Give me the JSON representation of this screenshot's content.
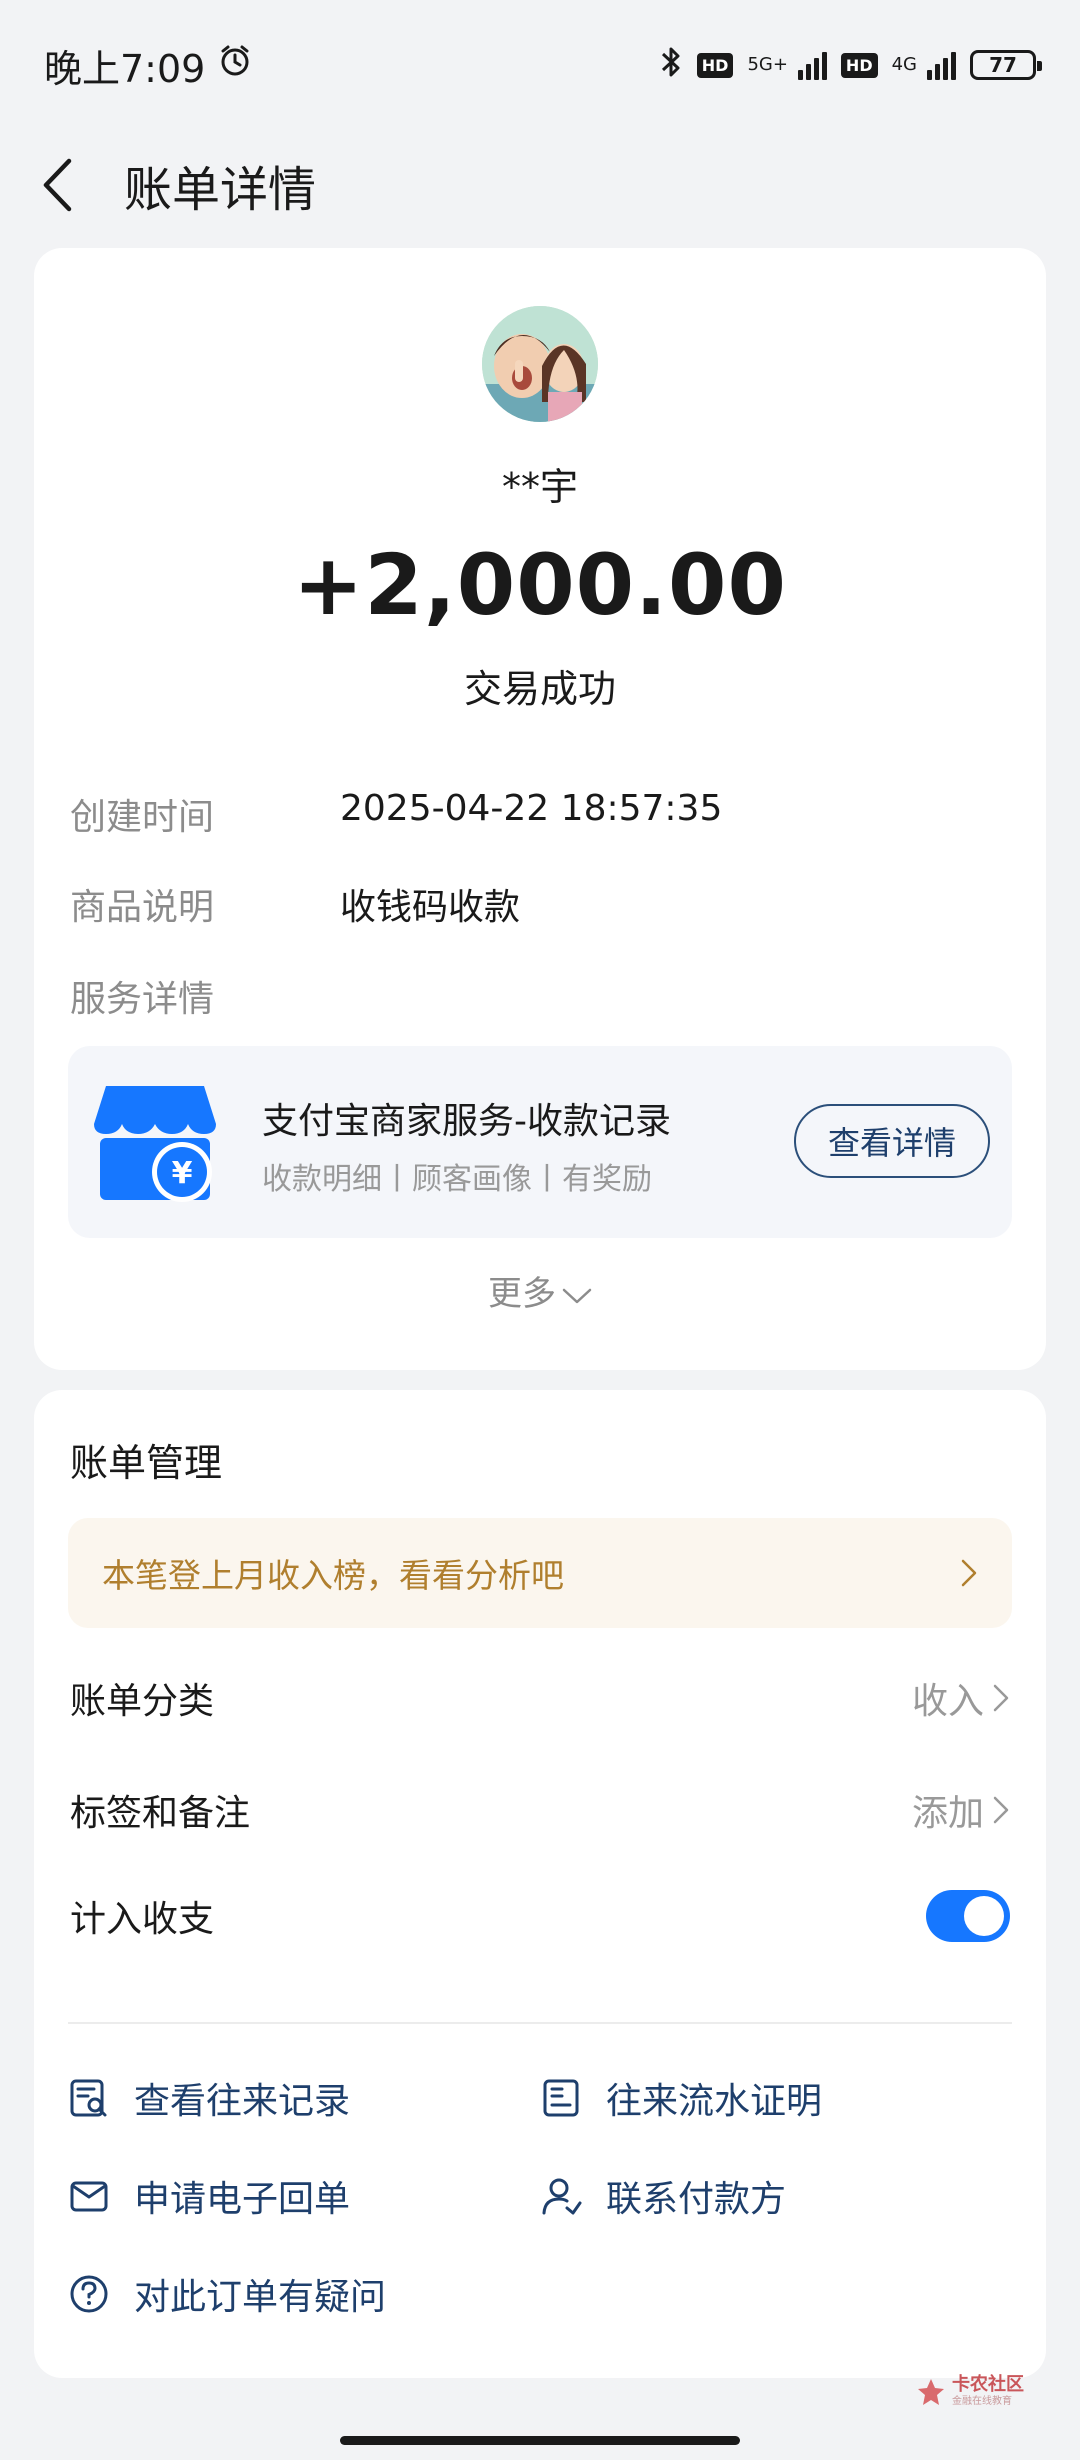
{
  "status_bar": {
    "time": "晚上7:09",
    "network_1": "5G+",
    "network_2": "4G",
    "hd": "HD",
    "battery": "77"
  },
  "nav": {
    "title": "账单详情"
  },
  "transaction": {
    "counterpart": "**宇",
    "amount": "+2,000.00",
    "status": "交易成功"
  },
  "details": {
    "created_label": "创建时间",
    "created_value": "2025-04-22 18:57:35",
    "desc_label": "商品说明",
    "desc_value": "收钱码收款",
    "service_label": "服务详情"
  },
  "service": {
    "title": "支付宝商家服务-收款记录",
    "subtitle": "收款明细丨顾客画像丨有奖励",
    "button": "查看详情"
  },
  "more": "更多",
  "management": {
    "title": "账单管理",
    "promo": "本笔登上月收入榜，看看分析吧",
    "category_label": "账单分类",
    "category_value": "收入",
    "tags_label": "标签和备注",
    "tags_value": "添加",
    "include_label": "计入收支",
    "include_on": true
  },
  "actions": {
    "history": "查看往来记录",
    "proof": "往来流水证明",
    "receipt": "申请电子回单",
    "contact": "联系付款方",
    "question": "对此订单有疑问"
  },
  "watermark": {
    "main": "卡农社区",
    "sub": "金融在线教育"
  },
  "colors": {
    "accent": "#1677ff",
    "link": "#1e3f6c",
    "promo": "#b07f2e"
  }
}
